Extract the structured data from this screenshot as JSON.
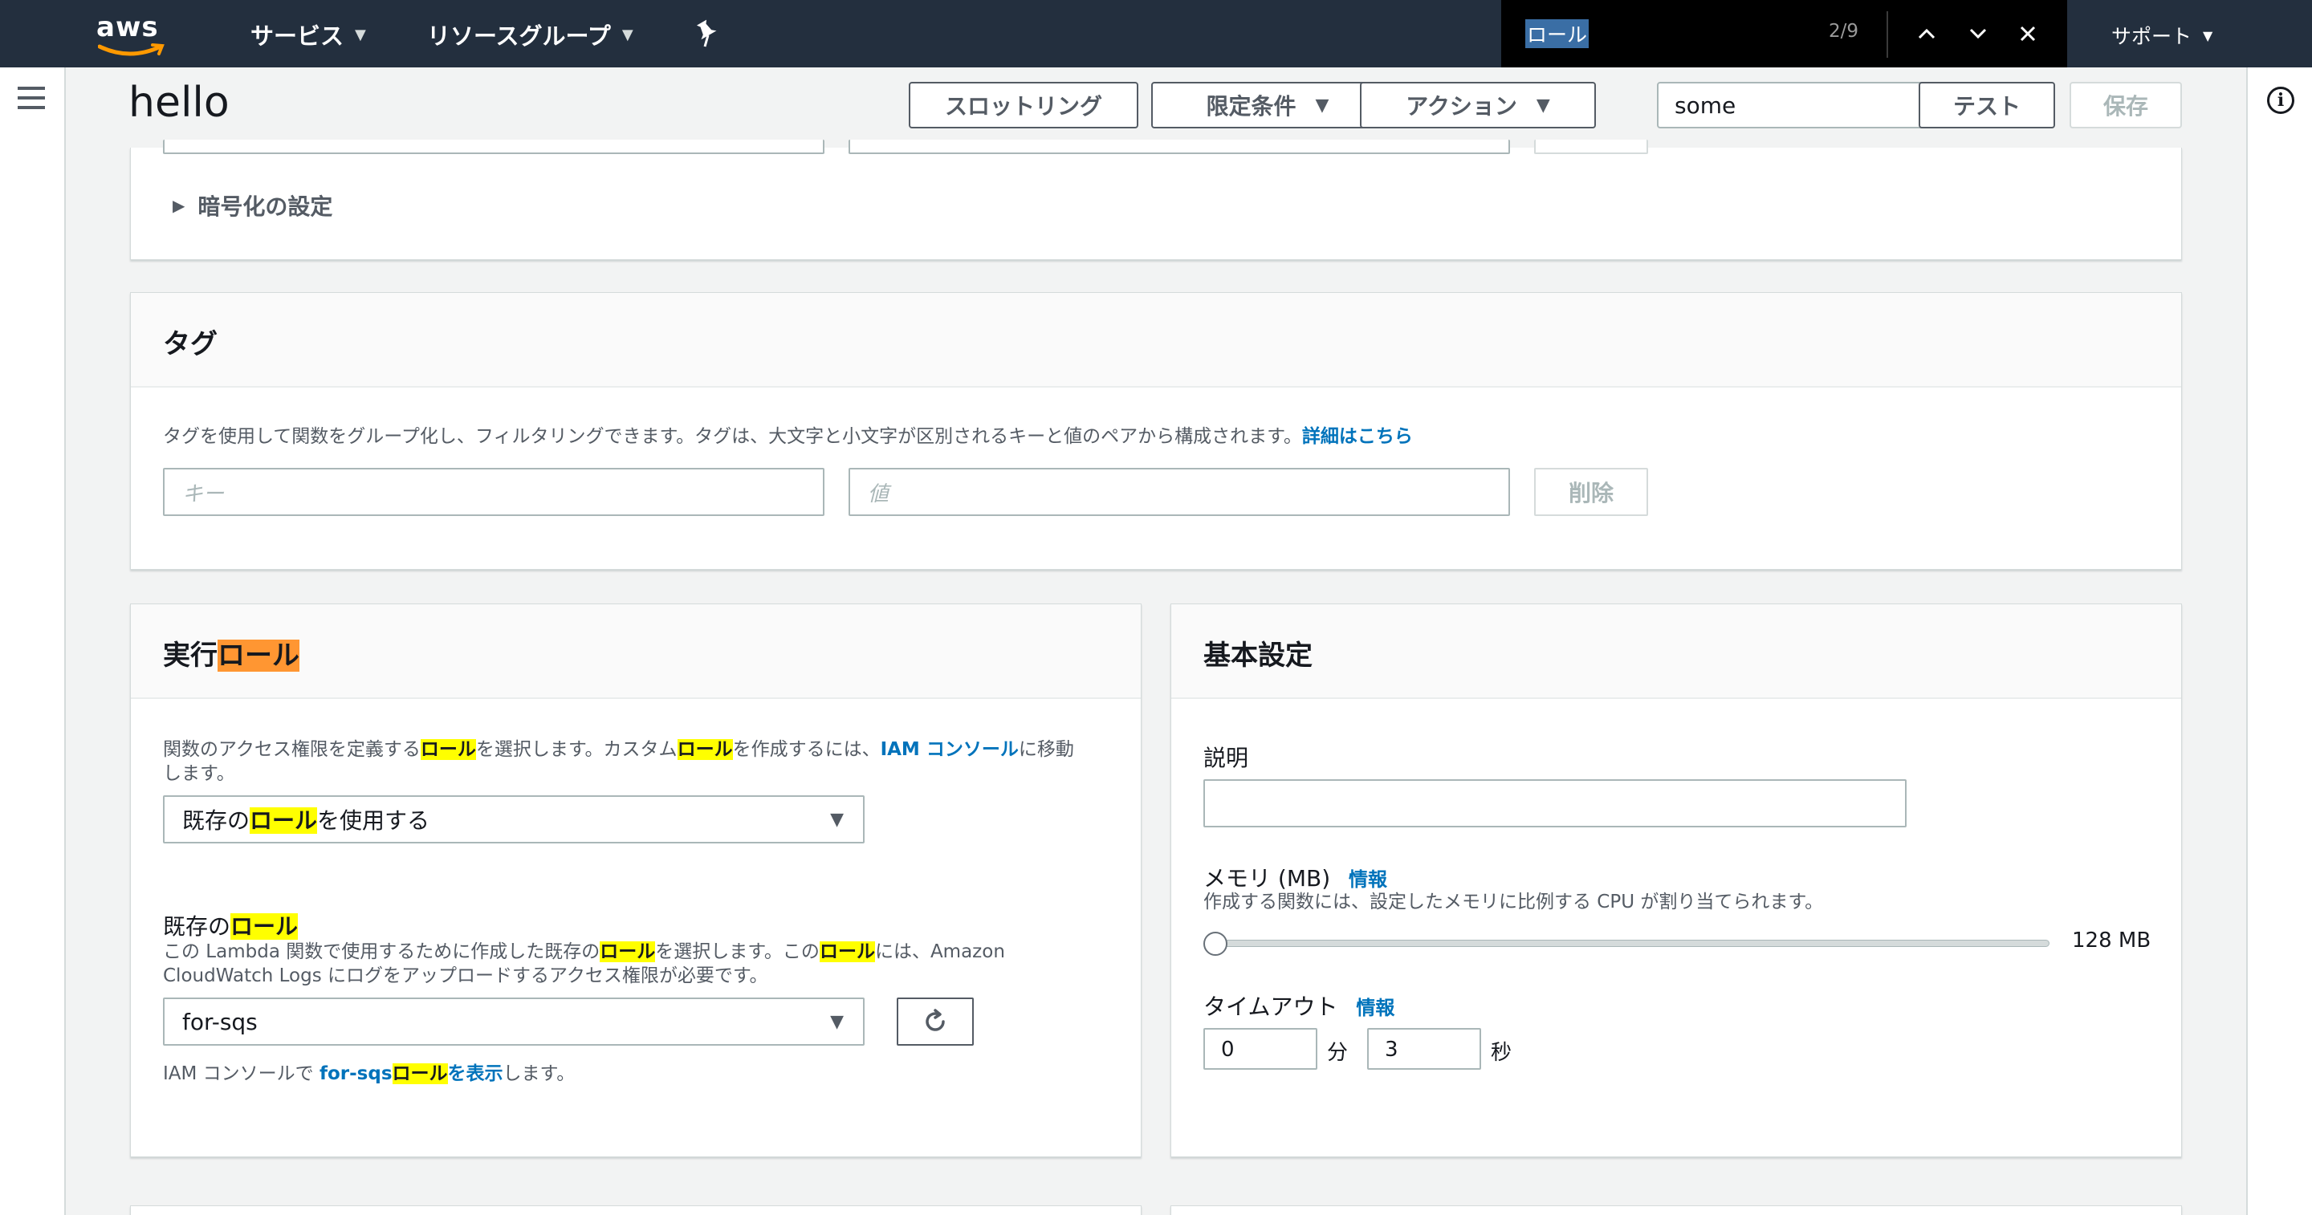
{
  "nav": {
    "logo": "aws",
    "services": "サービス",
    "resource_groups": "リソースグループ",
    "support": "サポート"
  },
  "find_bar": {
    "query": "ロール",
    "count": "2/9"
  },
  "header": {
    "title": "hello",
    "throttling": "スロットリング",
    "qualifiers": "限定条件",
    "actions": "アクション",
    "test_event": "some",
    "test": "テスト",
    "save": "保存"
  },
  "encryption": {
    "label": "暗号化の設定"
  },
  "tags": {
    "title": "タグ",
    "description": "タグを使用して関数をグループ化し、フィルタリングできます。タグは、大文字と小文字が区別されるキーと値のペアから構成されます。",
    "details_link": "詳細はこちら",
    "key_placeholder": "キー",
    "value_placeholder": "値",
    "delete": "削除"
  },
  "execution_role": {
    "title_prefix": "実行",
    "title_match": "ロール",
    "desc_1": "関数のアクセス権限を定義する",
    "desc_match_1": "ロール",
    "desc_2": "を選択します。カスタム",
    "desc_match_2": "ロール",
    "desc_3": "を作成するには、",
    "iam_link": "IAM コンソール",
    "desc_4": "に移動",
    "desc_5": "します。",
    "role_option_prefix": "既存の",
    "role_option_match": "ロール",
    "role_option_suffix": "を使用する",
    "existing_prefix": "既存の",
    "existing_match": "ロール",
    "existing_desc_1": "この Lambda 関数で使用するために作成した既存の",
    "existing_desc_match_1": "ロール",
    "existing_desc_2": "を選択します。この",
    "existing_desc_match_2": "ロール",
    "existing_desc_3": "には、Amazon",
    "existing_desc_4": "CloudWatch Logs にログをアップロードするアクセス権限が必要です。",
    "selected_role": "for-sqs",
    "footer_1": "IAM コンソールで ",
    "footer_link_1": "for-sqs",
    "footer_match": "ロール",
    "footer_link_2": "を表示",
    "footer_2": "します。"
  },
  "basic_settings": {
    "title": "基本設定",
    "description_label": "説明",
    "description_value": "",
    "memory_label": "メモリ (MB)",
    "memory_info": "情報",
    "memory_desc": "作成する関数には、設定したメモリに比例する CPU が割り当てられます。",
    "memory_value": "128 MB",
    "memory_fraction": 0.0,
    "timeout_label": "タイムアウト",
    "timeout_info": "情報",
    "timeout_min": "0",
    "min_unit": "分",
    "timeout_sec": "3",
    "sec_unit": "秒"
  },
  "colors": {
    "nav_bg": "#232f3e",
    "link": "#0073bb",
    "highlight": "#ffff00",
    "current_highlight": "#ff9632"
  }
}
